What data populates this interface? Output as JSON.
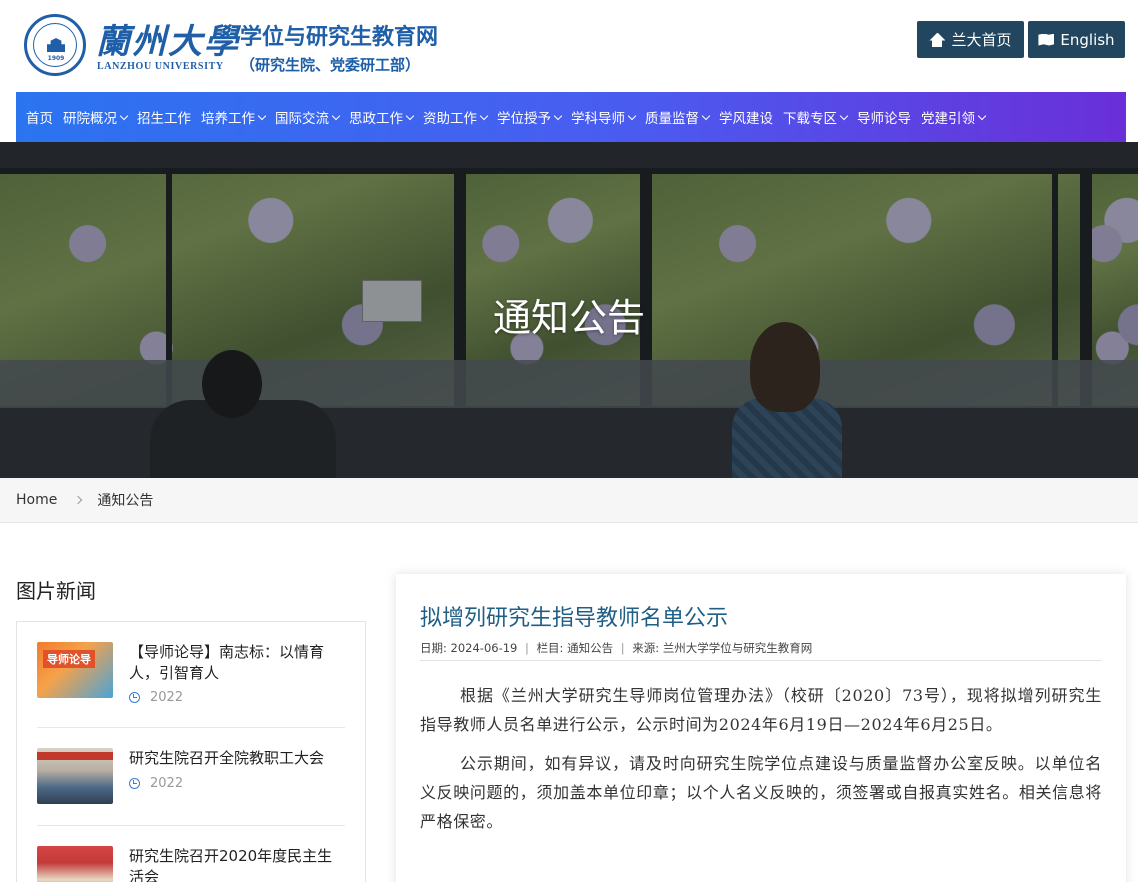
{
  "header": {
    "logo_cn": "蘭州大學",
    "logo_en": "LANZHOU UNIVERSITY",
    "seal_year": "1909",
    "site_title": "学位与研究生教育网",
    "site_subtitle": "（研究生院、党委研工部）",
    "home_button": "兰大首页",
    "english_button": "English",
    "accent_color": "#1f5fa8",
    "button_color": "#22465f"
  },
  "nav": {
    "items": [
      {
        "label": "首页",
        "dropdown": false
      },
      {
        "label": "研院概况",
        "dropdown": true
      },
      {
        "label": "招生工作",
        "dropdown": false
      },
      {
        "label": "培养工作",
        "dropdown": true
      },
      {
        "label": "国际交流",
        "dropdown": true
      },
      {
        "label": "思政工作",
        "dropdown": true
      },
      {
        "label": "资助工作",
        "dropdown": true
      },
      {
        "label": "学位授予",
        "dropdown": true
      },
      {
        "label": "学科导师",
        "dropdown": true
      },
      {
        "label": "质量监督",
        "dropdown": true
      },
      {
        "label": "学风建设",
        "dropdown": false
      },
      {
        "label": "下载专区",
        "dropdown": true
      },
      {
        "label": "导师论导",
        "dropdown": false
      },
      {
        "label": "党建引领",
        "dropdown": true
      }
    ]
  },
  "banner": {
    "title": "通知公告"
  },
  "breadcrumb": {
    "home": "Home",
    "current": "通知公告"
  },
  "sidebar": {
    "title": "图片新闻",
    "thumb1_label": "导师论导",
    "items": [
      {
        "title": "【导师论导】南志标：以情育人，引智育人",
        "date": "2022"
      },
      {
        "title": "研究生院召开全院教职工大会",
        "date": "2022"
      },
      {
        "title": "研究生院召开2020年度民主生活会",
        "date": ""
      }
    ]
  },
  "article": {
    "title": "拟增列研究生指导教师名单公示",
    "meta_date_label": "日期:",
    "meta_date": "2024-06-19",
    "meta_column_label": "栏目:",
    "meta_column": "通知公告",
    "meta_source_label": "来源:",
    "meta_source": "兰州大学学位与研究生教育网",
    "paragraphs": [
      "根据《兰州大学研究生导师岗位管理办法》（校研〔2020〕73号），现将拟增列研究生指导教师人员名单进行公示，公示时间为2024年6月19日—2024年6月25日。",
      "公示期间，如有异议，请及时向研究生院学位点建设与质量监督办公室反映。以单位名义反映问题的，须加盖本单位印章；以个人名义反映的，须签署或自报真实姓名。相关信息将严格保密。"
    ]
  }
}
